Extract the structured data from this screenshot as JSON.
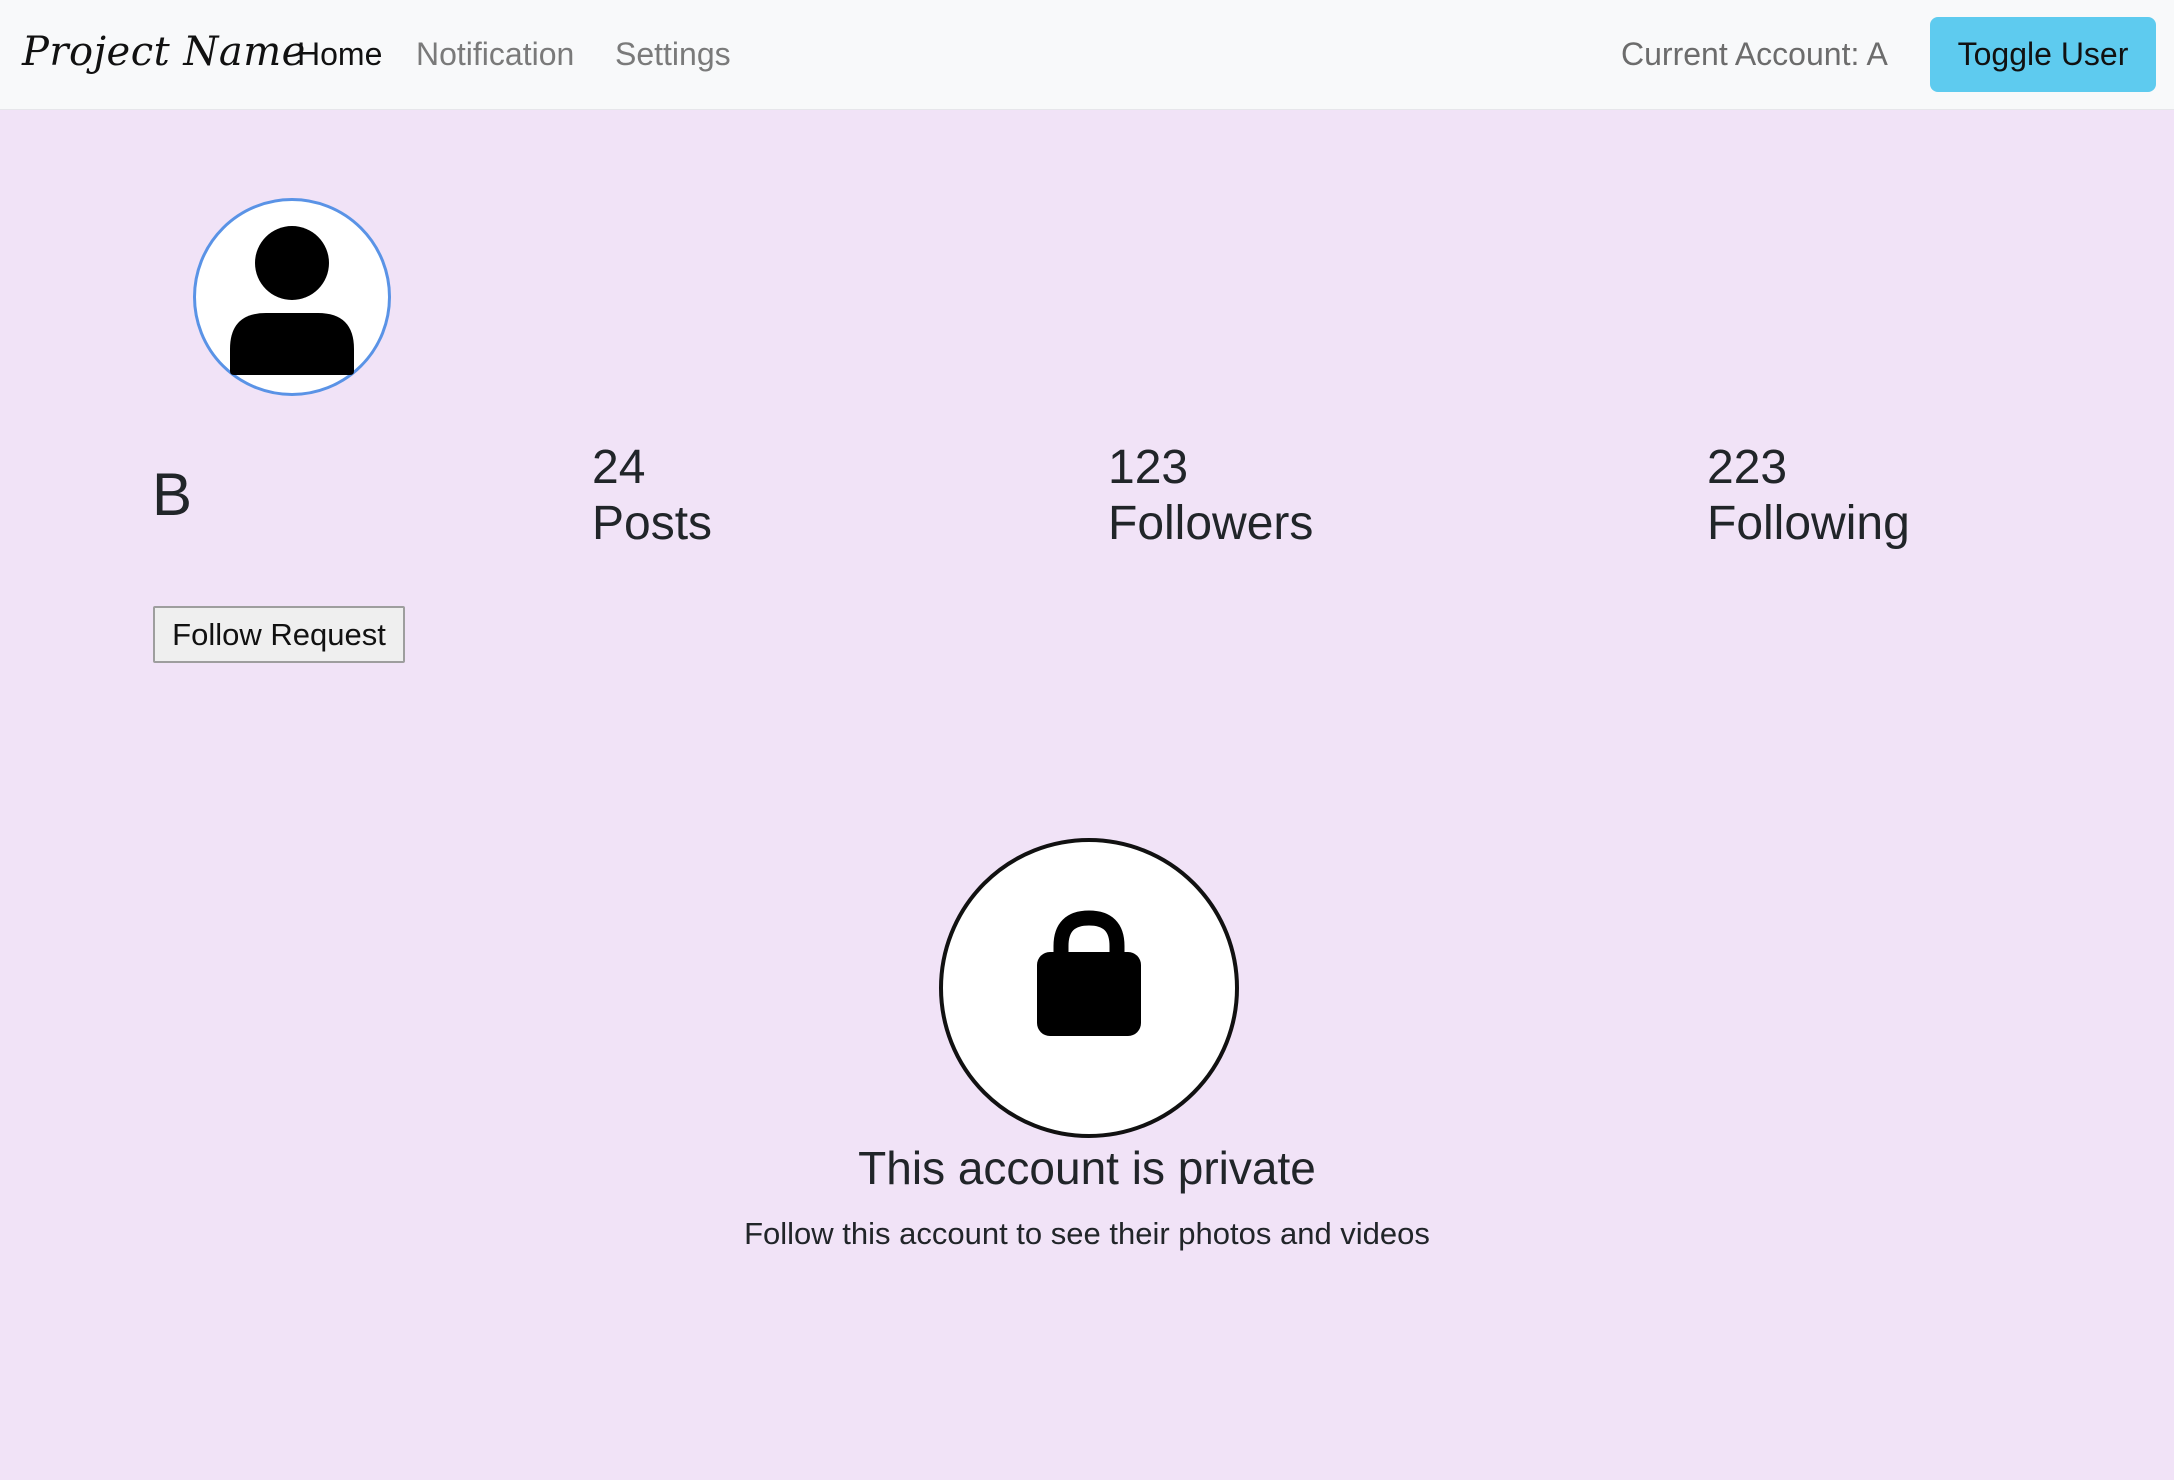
{
  "navbar": {
    "brand": "Project Name",
    "links": [
      {
        "label": "Home",
        "active": true
      },
      {
        "label": "Notification",
        "active": false
      },
      {
        "label": "Settings",
        "active": false
      }
    ],
    "current_account": "Current Account: A",
    "toggle_label": "Toggle User"
  },
  "profile": {
    "avatar_icon": "person-icon",
    "username": "B",
    "stats": {
      "posts": {
        "value": "24",
        "label": "Posts"
      },
      "followers": {
        "value": "123",
        "label": "Followers"
      },
      "following": {
        "value": "223",
        "label": "Following"
      }
    },
    "follow_button": "Follow Request"
  },
  "private": {
    "icon": "lock-icon",
    "title": "This account is private",
    "subtitle": "Follow this account to see their photos and videos"
  },
  "colors": {
    "page_background": "#f1e3f7",
    "navbar_background": "#f8f9fa",
    "toggle_button": "#5ecbef",
    "avatar_border": "#5a93e6"
  }
}
